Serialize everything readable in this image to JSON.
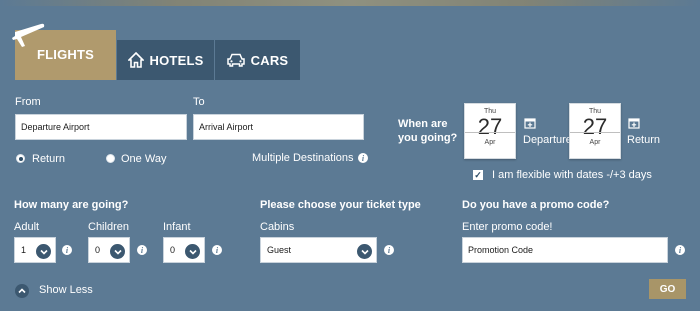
{
  "colors": {
    "background": "#5c7a94",
    "active_tab": "#b09a6d",
    "inactive_tab": "#3c5870",
    "go_button": "#a89568"
  },
  "tabs": [
    {
      "label": "FLIGHTS",
      "icon": "plane-icon",
      "active": true
    },
    {
      "label": "HOTELS",
      "icon": "house-icon",
      "active": false
    },
    {
      "label": "CARS",
      "icon": "car-icon",
      "active": false
    }
  ],
  "from": {
    "label": "From",
    "placeholder": "Departure Airport"
  },
  "to": {
    "label": "To",
    "placeholder": "Arrival Airport"
  },
  "trip_type": {
    "return_label": "Return",
    "oneway_label": "One Way",
    "selected": "Return"
  },
  "multiple_destinations": "Multiple Destinations",
  "when": {
    "label_line1": "When are",
    "label_line2": "you going?",
    "departure": {
      "dow": "Thu",
      "day": "27",
      "month": "Apr",
      "label": "Departure"
    },
    "return": {
      "dow": "Thu",
      "day": "27",
      "month": "Apr",
      "label": "Return"
    },
    "flexible_label": "I am flexible with dates -/+3 days",
    "flexible_checked": true
  },
  "passengers": {
    "heading": "How many are going?",
    "adult": {
      "label": "Adult",
      "value": "1"
    },
    "children": {
      "label": "Children",
      "value": "0"
    },
    "infant": {
      "label": "Infant",
      "value": "0"
    }
  },
  "ticket": {
    "heading": "Please choose your ticket type",
    "cabins_label": "Cabins",
    "cabins_value": "Guest"
  },
  "promo": {
    "heading": "Do you have a promo code?",
    "label": "Enter promo code!",
    "placeholder": "Promotion Code"
  },
  "show_less": "Show Less",
  "go": "GO"
}
